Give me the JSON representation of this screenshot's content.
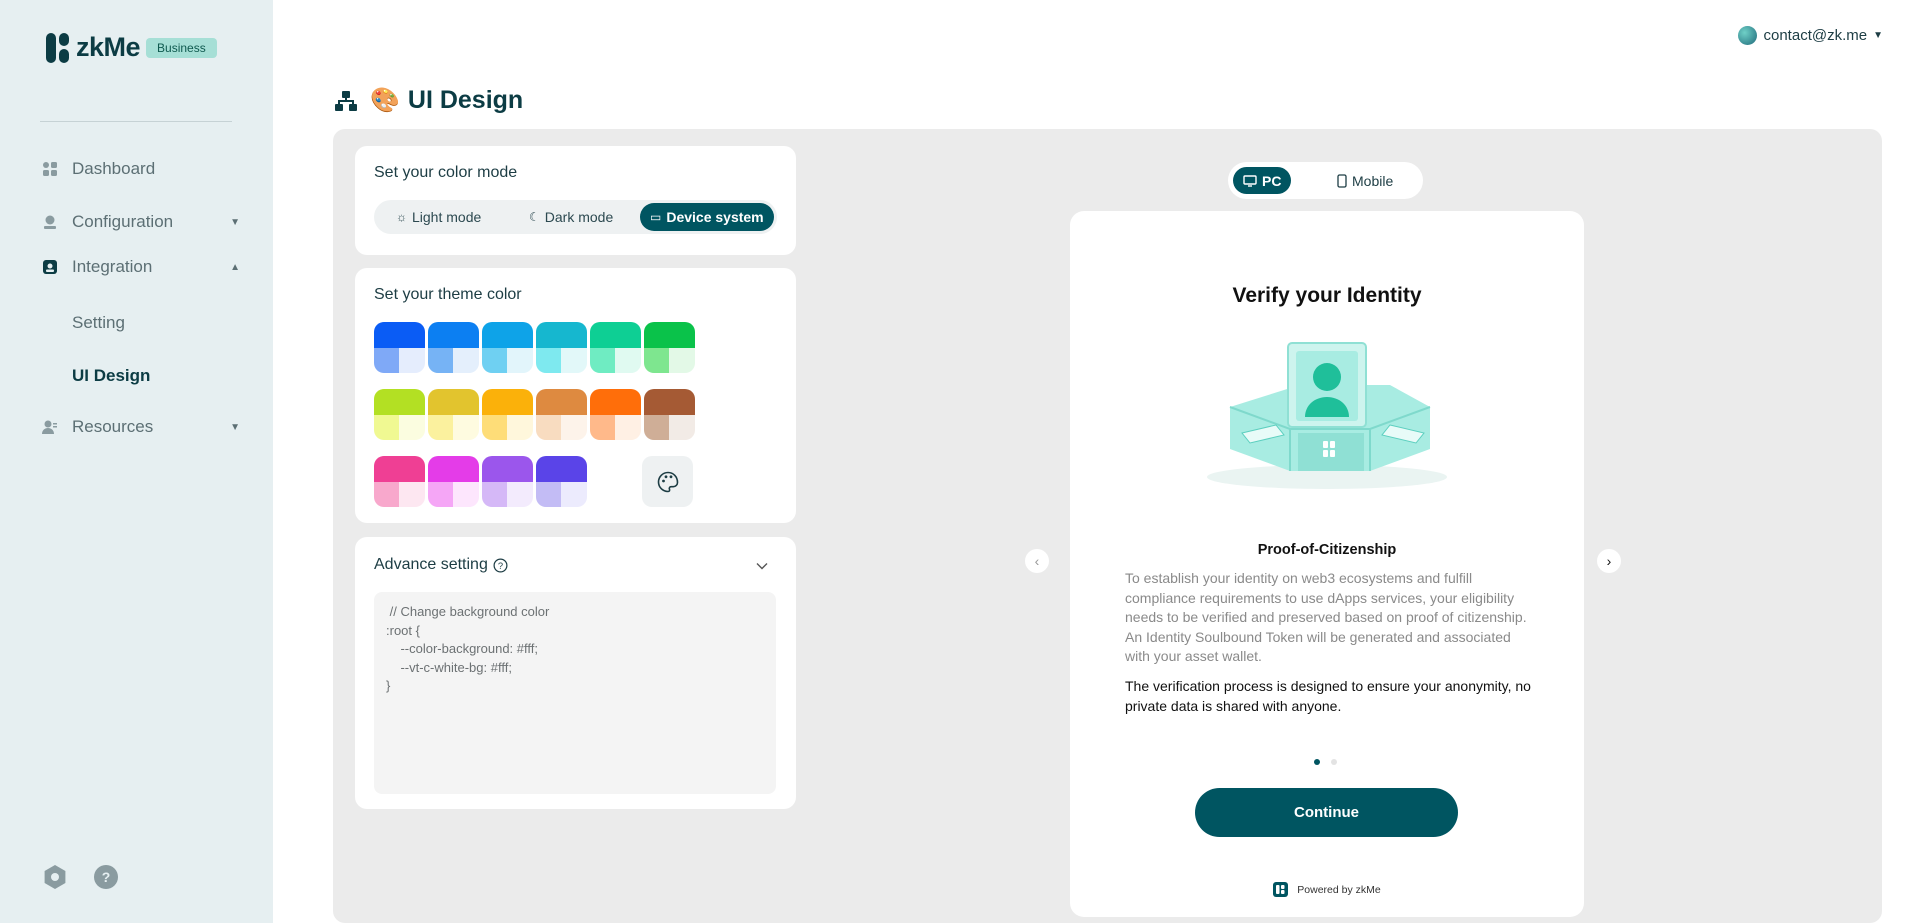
{
  "brand": {
    "name": "zkMe",
    "badge": "Business"
  },
  "sidebar": {
    "nav": [
      {
        "label": "Dashboard",
        "icon": "dashboard-icon"
      },
      {
        "label": "Configuration",
        "icon": "config-icon"
      },
      {
        "label": "Integration",
        "icon": "integration-icon"
      },
      {
        "label": "Resources",
        "icon": "resources-icon"
      }
    ],
    "integration_sub": [
      {
        "label": "Setting"
      },
      {
        "label": "UI Design",
        "active": true
      }
    ],
    "bottom_icons": [
      "settings-hex-icon",
      "help-icon"
    ]
  },
  "user": {
    "email": "contact@zk.me"
  },
  "page": {
    "title": "UI Design",
    "title_emoji": "🎨"
  },
  "color_mode": {
    "title": "Set your color mode",
    "options": [
      "Light mode",
      "Dark mode",
      "Device system"
    ],
    "selected": "Device system"
  },
  "theme": {
    "title": "Set your theme color",
    "swatches": [
      {
        "main": "#0a5cf5",
        "light": "#7fa9f7",
        "lighter": "#e5edfd"
      },
      {
        "main": "#0c7ff2",
        "light": "#76b3f5",
        "lighter": "#e4effc"
      },
      {
        "main": "#0ea3e8",
        "light": "#6fd0f2",
        "lighter": "#e2f5fb"
      },
      {
        "main": "#16b7cf",
        "light": "#7ee9ef",
        "lighter": "#e2f8f9"
      },
      {
        "main": "#0ecf94",
        "light": "#6fecc2",
        "lighter": "#e0faf1"
      },
      {
        "main": "#0ac24a",
        "light": "#7ee68f",
        "lighter": "#e3f9e7"
      },
      {
        "main": "#b3e023",
        "light": "#f0f992",
        "lighter": "#fbfde0"
      },
      {
        "main": "#e2c42e",
        "light": "#fbf19e",
        "lighter": "#fefbe0"
      },
      {
        "main": "#fbb10a",
        "light": "#fedd78",
        "lighter": "#fff7dc"
      },
      {
        "main": "#de8a40",
        "light": "#f8dcc0",
        "lighter": "#fdf3ea"
      },
      {
        "main": "#ff6e0a",
        "light": "#ffb98a",
        "lighter": "#fff0e4"
      },
      {
        "main": "#a55a34",
        "light": "#cfae97",
        "lighter": "#f2ebe6"
      },
      {
        "main": "#ef3f94",
        "light": "#f8a8cc",
        "lighter": "#fde7f1"
      },
      {
        "main": "#e43ce8",
        "light": "#f5a6f6",
        "lighter": "#fde6fd"
      },
      {
        "main": "#9b56ec",
        "light": "#d5b8f7",
        "lighter": "#f3ebfd"
      },
      {
        "main": "#5a44e8",
        "light": "#c3bcf5",
        "lighter": "#ecebfd"
      }
    ],
    "custom_icon": "palette-icon"
  },
  "advance": {
    "title": "Advance setting",
    "code_lines": [
      " // Change background color",
      ":root {",
      "    --color-background: #fff;",
      "    --vt-c-white-bg: #fff;",
      "}"
    ]
  },
  "device_toggle": {
    "options": [
      "PC",
      "Mobile"
    ],
    "selected": "PC"
  },
  "preview": {
    "title": "Verify your Identity",
    "subtitle": "Proof-of-Citizenship",
    "description": "To establish your identity on web3 ecosystems and fulfill compliance requirements to use dApps services, your eligibility needs to be verified and preserved based on proof of citizenship. An Identity Soulbound Token will be generated and associated with your asset wallet.",
    "note": "The verification process is designed to ensure your anonymity, no private data is shared with anyone.",
    "button": "Continue",
    "powered": "Powered by zkMe",
    "page_index": 1,
    "page_count": 2
  },
  "colors": {
    "accent": "#005561",
    "sidebar_bg": "#e6eff1",
    "panel_bg": "#ebebeb"
  }
}
